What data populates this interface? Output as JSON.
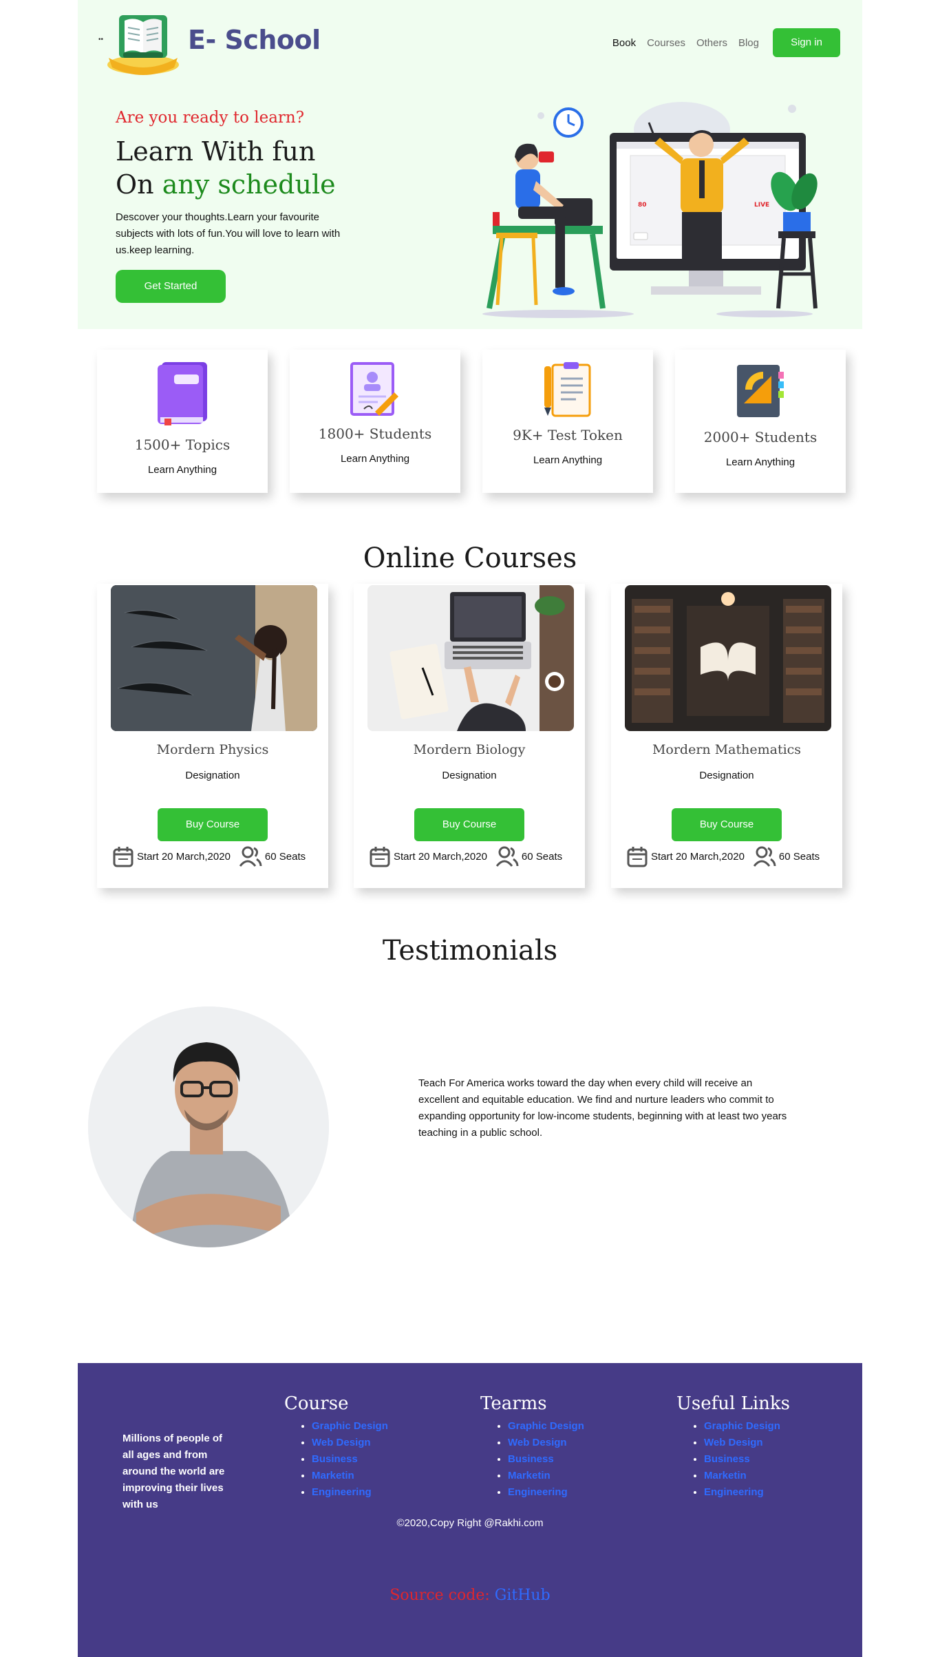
{
  "brand": {
    "name": "E- School"
  },
  "nav": {
    "items": [
      "Book",
      "Courses",
      "Others",
      "Blog"
    ],
    "signin": "Sign in"
  },
  "hero": {
    "subtitle": "Are you ready to learn?",
    "title_line1": "Learn With fun",
    "title_line2_prefix": "On ",
    "title_line2_highlight": "any schedule",
    "description": "Descover your thoughts.Learn your favourite subjects with lots of fun.You will love to learn with us.keep learning.",
    "cta": "Get Started",
    "illustration_badge_left": "80",
    "illustration_badge_right": "LIVE"
  },
  "stats": [
    {
      "title": "1500+ Topics",
      "subtitle": "Learn Anything",
      "icon": "book-icon"
    },
    {
      "title": "1800+ Students",
      "subtitle": "Learn Anything",
      "icon": "certificate-icon"
    },
    {
      "title": "9K+ Test Token",
      "subtitle": "Learn Anything",
      "icon": "clipboard-icon"
    },
    {
      "title": "2000+ Students",
      "subtitle": "Learn Anything",
      "icon": "geometry-book-icon"
    }
  ],
  "courses": {
    "title": "Online Courses",
    "items": [
      {
        "name": "Mordern Physics",
        "designation": "Designation",
        "button": "Buy Course",
        "date": "Start 20 March,2020",
        "seats": "60 Seats"
      },
      {
        "name": "Mordern Biology",
        "designation": "Designation",
        "button": "Buy Course",
        "date": "Start 20 March,2020",
        "seats": "60 Seats"
      },
      {
        "name": "Mordern Mathematics",
        "designation": "Designation",
        "button": "Buy Course",
        "date": "Start 20 March,2020",
        "seats": "60 Seats"
      }
    ]
  },
  "testimonials": {
    "title": "Testimonials",
    "quote": "Teach For America works toward the day when every child will receive an excellent and equitable education. We find and nurture leaders who commit to expanding opportunity for low-income students, beginning with at least two years teaching in a public school."
  },
  "footer": {
    "intro": "Millions of people of all ages and from around the world are improving their lives with us",
    "columns": [
      {
        "title": "Course",
        "links": [
          "Graphic Design",
          "Web Design",
          "Business",
          "Marketin",
          "Engineering"
        ]
      },
      {
        "title": "Tearms",
        "links": [
          "Graphic Design",
          "Web Design",
          "Business",
          "Marketin",
          "Engineering"
        ]
      },
      {
        "title": "Useful Links",
        "links": [
          "Graphic Design",
          "Web Design",
          "Business",
          "Marketin",
          "Engineering"
        ]
      }
    ],
    "copyright": "©2020,Copy Right @Rakhi.com",
    "source_label": "Source code: ",
    "source_link": "GitHub"
  }
}
